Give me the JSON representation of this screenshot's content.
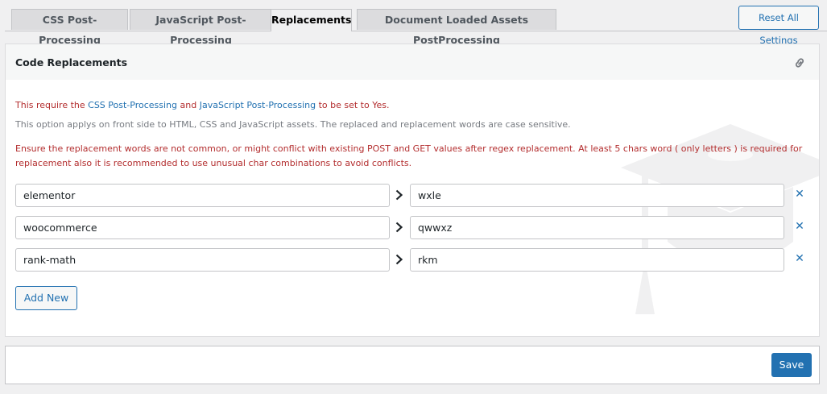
{
  "tabs": [
    {
      "label": "CSS Post-Processing",
      "active": false
    },
    {
      "label": "JavaScript Post-Processing",
      "active": false
    },
    {
      "label": "Replacements",
      "active": true
    },
    {
      "label": "Document Loaded Assets PostProcessing",
      "active": false
    }
  ],
  "reset_label": "Reset All Settings",
  "panel": {
    "title": "Code Replacements",
    "requirement": {
      "prefix": "This require the ",
      "link1": "CSS Post-Processing",
      "middle": " and ",
      "link2": "JavaScript Post-Processing",
      "suffix": " to be set to Yes."
    },
    "info": "This option applys on front side to HTML, CSS and JavaScript assets. The replaced and replacement words are case sensitive.",
    "warning_line1": "Ensure the replacement words are not common, or might conflict with existing POST and GET values after regex replacement. At least 5 chars word ( only letters ) is required for",
    "warning_line2": "replacement also it is recommended to use unusual char combinations to avoid conflicts.",
    "rows": [
      {
        "from": "elementor",
        "to": "wxle"
      },
      {
        "from": "woocommerce",
        "to": "qwwxz"
      },
      {
        "from": "rank-math",
        "to": "rkm"
      }
    ],
    "add_label": "Add New"
  },
  "footer": {
    "save_label": "Save"
  },
  "colors": {
    "accent": "#2271b1",
    "warning": "#b32d2e",
    "muted": "#787c82"
  },
  "icons": {
    "link": "link-icon",
    "arrow": "chevron-right-icon",
    "remove": "close-icon",
    "watermark": "graduation-cap-icon"
  }
}
